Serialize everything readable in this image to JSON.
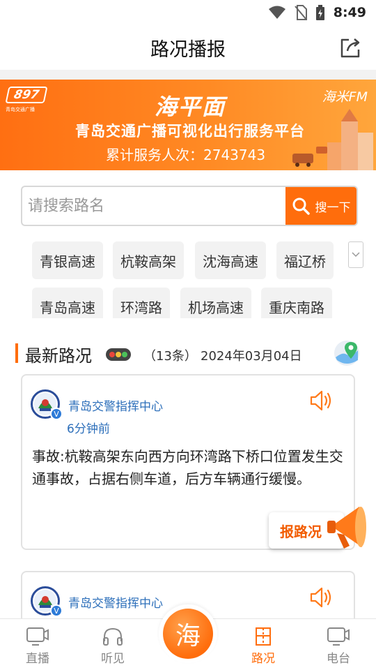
{
  "status_bar": {
    "time": "8:49"
  },
  "header": {
    "title": "路况播报"
  },
  "banner": {
    "brand_logo": "897",
    "brand_sub": "青岛交通广播",
    "calligraphy": "海平面",
    "headline": "青岛交通广播可视化出行服务平台",
    "service_count": "累计服务人次：2743743",
    "fm_logo": "海米FM"
  },
  "search": {
    "placeholder": "请搜索路名",
    "button_label": "搜一下"
  },
  "tags": [
    "青银高速",
    "杭鞍高架",
    "沈海高速",
    "福辽桥",
    "青岛高速",
    "环湾路",
    "机场高速",
    "重庆南路"
  ],
  "section": {
    "title": "最新路况",
    "count": "（13条）",
    "date": "2024年03月04日"
  },
  "posts": [
    {
      "author": "青岛交警指挥中心",
      "time": "6分钟前",
      "content": "事故:杭鞍高架东向西方向环湾路下桥口位置发生交通事故，占据右侧车道，后方车辆通行缓慢。"
    },
    {
      "author": "青岛交警指挥中心",
      "time": "",
      "content": ""
    }
  ],
  "report_button": {
    "label": "报路况"
  },
  "nav": {
    "items": [
      {
        "label": "直播",
        "icon": "tv-icon"
      },
      {
        "label": "听见",
        "icon": "headphones-icon"
      },
      {
        "label": "路况",
        "icon": "road-icon"
      },
      {
        "label": "电台",
        "icon": "radio-icon"
      }
    ],
    "center_label": "海"
  },
  "colors": {
    "accent": "#ff6d0c",
    "link": "#2d6fba"
  }
}
